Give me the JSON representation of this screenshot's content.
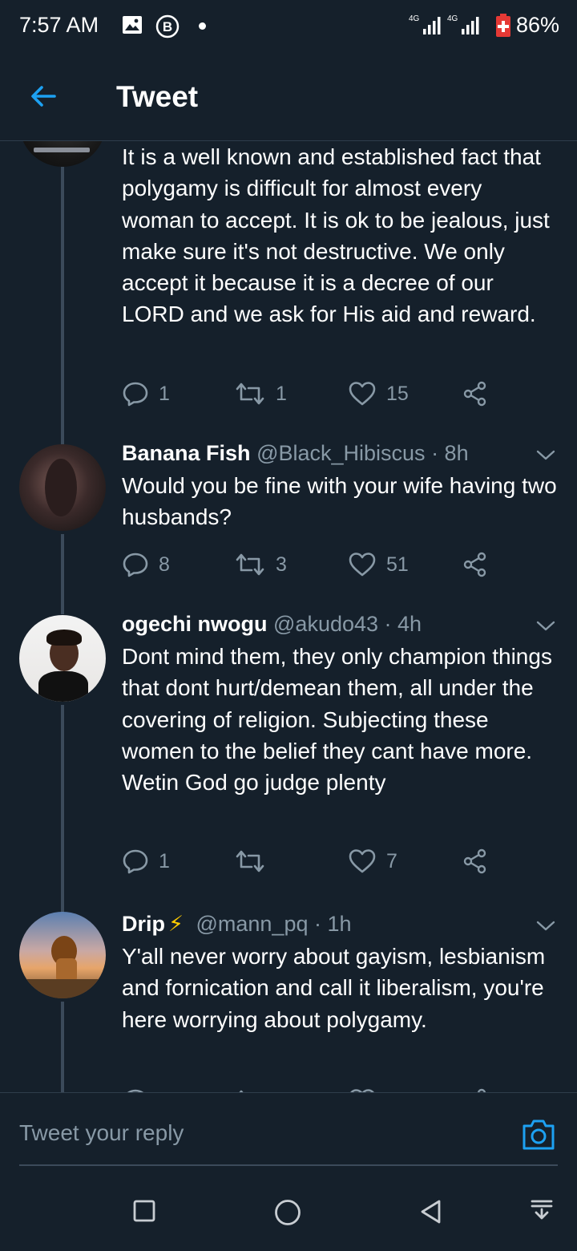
{
  "status_bar": {
    "time": "7:57 AM",
    "network_label": "4G",
    "network_label2": "4G",
    "battery": "86%"
  },
  "header": {
    "title": "Tweet",
    "back_icon": "arrow-left-icon"
  },
  "tweets": [
    {
      "text": "It is a well known and established fact that polygamy is difficult for almost every woman to accept. It is ok to be jealous, just make sure it's not destructive. We only accept it because it is a decree of our LORD and we ask for His aid and reward.",
      "replies": "1",
      "retweets": "1",
      "likes": "15"
    },
    {
      "name": "Banana Fish",
      "handle": "@Black_Hibiscus",
      "time": "· 8h",
      "text": "Would you be fine with your wife having two husbands?",
      "replies": "8",
      "retweets": "3",
      "likes": "51"
    },
    {
      "name": "ogechi nwogu",
      "handle": "@akudo43",
      "time": "· 4h",
      "text": "Dont mind them, they only champion things that dont hurt/demean them, all under the covering of religion. Subjecting these women to the belief they cant have more. Wetin God go judge plenty",
      "replies": "1",
      "retweets": "",
      "likes": "7"
    },
    {
      "name": "Drip",
      "name_emoji": "⚡",
      "handle": "@mann_pq",
      "time": "· 1h",
      "text": "Y'all never worry about gayism, lesbianism and fornication and call it liberalism, you're here worrying about polygamy."
    }
  ],
  "reply_bar": {
    "placeholder": "Tweet your reply",
    "camera_icon": "camera-icon"
  },
  "nav_bar": {
    "buttons": [
      "recents-square-icon",
      "home-circle-icon",
      "back-triangle-icon",
      "notification-pull-icon"
    ]
  },
  "colors": {
    "background": "#15202b",
    "accent": "#1da1f2",
    "muted": "#8899a6",
    "divider": "#2f3d4b",
    "lightning": "#ffcc00",
    "battery_red": "#e53935"
  }
}
